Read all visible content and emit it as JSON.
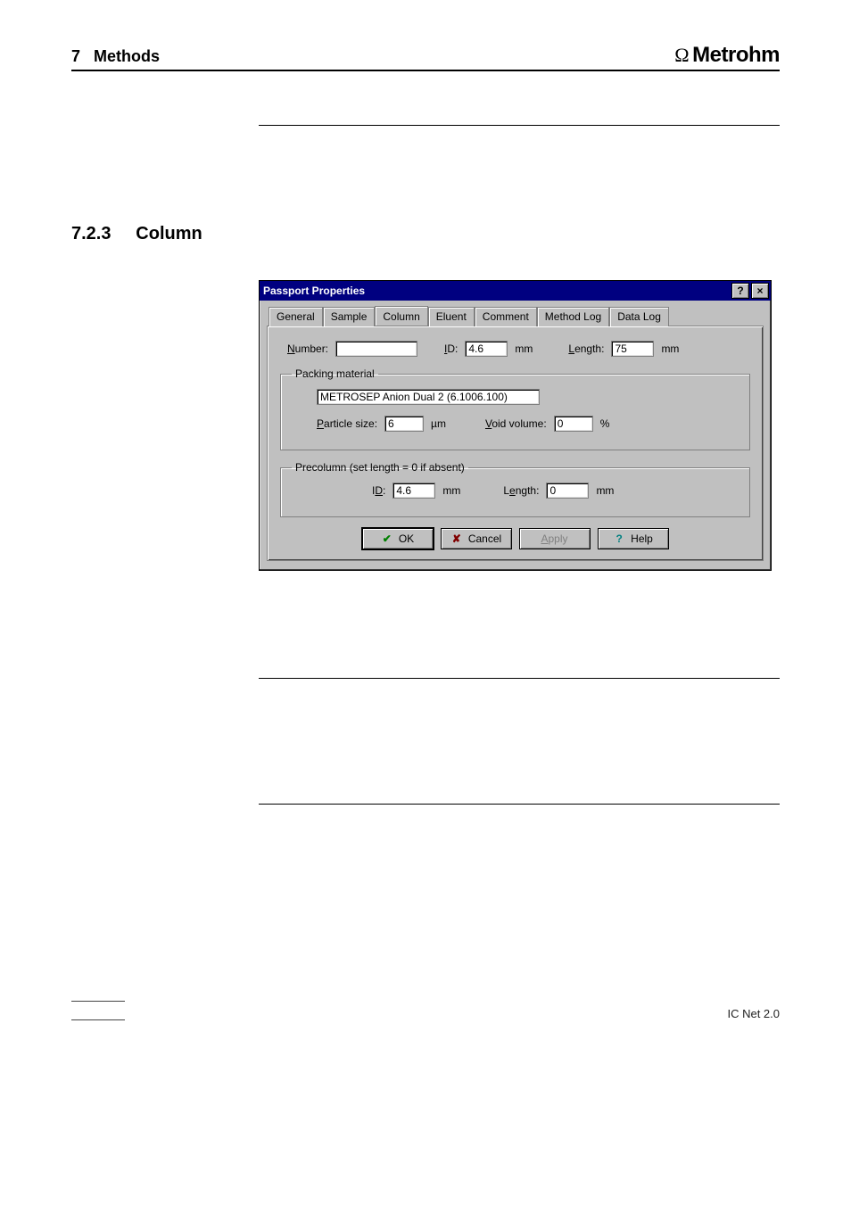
{
  "header": {
    "section_no": "7",
    "section_title": "Methods",
    "brand": "Metrohm"
  },
  "section": {
    "number": "7.2.3",
    "title": "Column"
  },
  "dialog": {
    "title": "Passport Properties",
    "tabs": [
      "General",
      "Sample",
      "Column",
      "Eluent",
      "Comment",
      "Method Log",
      "Data Log"
    ],
    "active_tab": 2,
    "row1": {
      "number_label_pre": "N",
      "number_label": "umber:",
      "number_value": "",
      "id_label_pre": "I",
      "id_label": "D:",
      "id_value": "4.6",
      "id_unit": "mm",
      "length_label_pre": "L",
      "length_label": "ength:",
      "length_value": "75",
      "length_unit": "mm"
    },
    "packing": {
      "legend": "Packing material",
      "name_value": "METROSEP Anion Dual 2 (6.1006.100)",
      "particle_label_pre": "P",
      "particle_label": "article size:",
      "particle_value": "6",
      "particle_unit": "µm",
      "void_label_pre": "V",
      "void_label": "oid volume:",
      "void_value": "0",
      "void_unit": "%"
    },
    "precolumn": {
      "legend": "Precolumn (set length = 0 if absent)",
      "id_label_pre_u": "D",
      "id_label_pre": "I",
      "id_label_post": ":",
      "id_value": "4.6",
      "id_unit": "mm",
      "length_label_pre_u": "e",
      "length_label_pre": "L",
      "length_label_post": "ngth:",
      "length_value": "0",
      "length_unit": "mm"
    },
    "buttons": {
      "ok": "OK",
      "cancel": "Cancel",
      "apply": "Apply",
      "help": "Help"
    }
  },
  "footer": {
    "product": "IC Net 2.0"
  }
}
